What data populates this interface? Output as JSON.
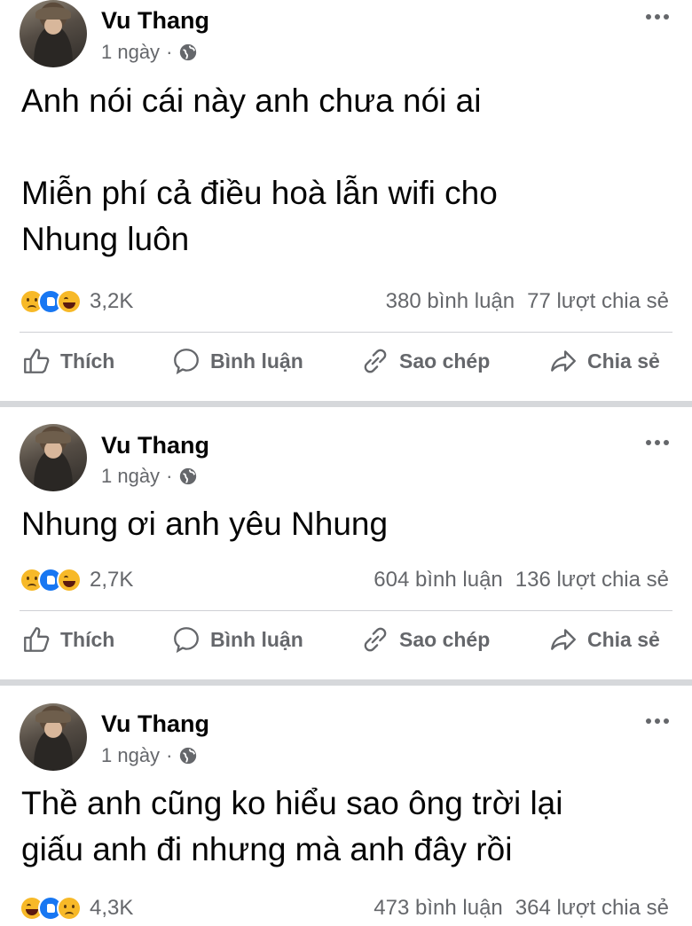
{
  "posts": [
    {
      "author": "Vu Thang",
      "time": "1 ngày",
      "dot": "·",
      "text": "Anh nói cái này anh chưa nói ai\n\nMiễn phí cả điều hoà lẫn wifi cho\nNhung luôn",
      "reactions": [
        "sad",
        "like",
        "haha"
      ],
      "reaction_count": "3,2K",
      "comments": "380 bình luận",
      "shares": "77 lượt chia sẻ"
    },
    {
      "author": "Vu Thang",
      "time": "1 ngày",
      "dot": "·",
      "text": "Nhung ơi anh yêu Nhung",
      "reactions": [
        "sad",
        "like",
        "haha"
      ],
      "reaction_count": "2,7K",
      "comments": "604 bình luận",
      "shares": "136 lượt chia sẻ"
    },
    {
      "author": "Vu Thang",
      "time": "1 ngày",
      "dot": "·",
      "text": "Thề anh cũng ko hiểu sao ông trời lại\ngiấu anh đi nhưng mà anh đây rồi",
      "reactions": [
        "haha",
        "like",
        "sad"
      ],
      "reaction_count": "4,3K",
      "comments": "473 bình luận",
      "shares": "364 lượt chia sẻ"
    }
  ],
  "actions": {
    "like": "Thích",
    "comment": "Bình luận",
    "copy": "Sao chép",
    "share": "Chia sẻ"
  },
  "colors": {
    "secondary_text": "#65676b",
    "separator": "#d6d8db",
    "like_blue": "#1877f2",
    "emoji_yellow": "#f7b928"
  },
  "icons": [
    "globe-icon",
    "more-icon",
    "like-icon",
    "comment-icon",
    "copy-link-icon",
    "share-icon"
  ]
}
